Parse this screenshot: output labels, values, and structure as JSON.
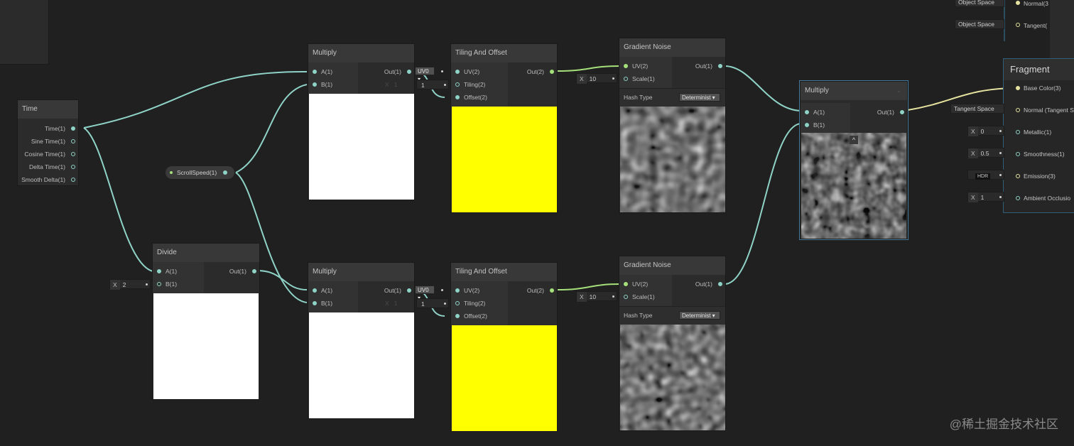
{
  "nodes": {
    "time": {
      "title": "Time",
      "outputs": [
        "Time(1)",
        "Sine Time(1)",
        "Cosine Time(1)",
        "Delta Time(1)",
        "Smooth Delta(1)"
      ]
    },
    "scroll_speed": {
      "label": "ScrollSpeed(1)"
    },
    "divide": {
      "title": "Divide",
      "in_a": "A(1)",
      "in_b": "B(1)",
      "out": "Out(1)",
      "b_axis": "X",
      "b_value": "2"
    },
    "multiply_top": {
      "title": "Multiply",
      "in_a": "A(1)",
      "in_b": "B(1)",
      "out": "Out(1)",
      "b_axis": "X",
      "b_value": "1"
    },
    "multiply_bottom": {
      "title": "Multiply",
      "in_a": "A(1)",
      "in_b": "B(1)",
      "out": "Out(1)",
      "b_axis": "X",
      "b_value": "1"
    },
    "tiling_top": {
      "title": "Tiling And Offset",
      "in_uv": "UV(2)",
      "in_tiling": "Tiling(2)",
      "in_offset": "Offset(2)",
      "out": "Out(2)",
      "uv_dropdown": "UV0",
      "tiling_value": "1"
    },
    "tiling_bottom": {
      "title": "Tiling And Offset",
      "in_uv": "UV(2)",
      "in_tiling": "Tiling(2)",
      "in_offset": "Offset(2)",
      "out": "Out(2)",
      "uv_dropdown": "UV0",
      "tiling_value": "1"
    },
    "noise_top": {
      "title": "Gradient Noise",
      "in_uv": "UV(2)",
      "in_scale": "Scale(1)",
      "out": "Out(1)",
      "scale_axis": "X",
      "scale_value": "10",
      "hash_label": "Hash Type",
      "hash_value": "Determinist"
    },
    "noise_bottom": {
      "title": "Gradient Noise",
      "in_uv": "UV(2)",
      "in_scale": "Scale(1)",
      "out": "Out(1)",
      "scale_axis": "X",
      "scale_value": "10",
      "hash_label": "Hash Type",
      "hash_value": "Determinist"
    },
    "multiply_final": {
      "title": "Multiply",
      "in_a": "A(1)",
      "in_b": "B(1)",
      "out": "Out(1)"
    }
  },
  "vertex_partial": {
    "inputs": [
      {
        "space": "Object Space",
        "port": "Normal(3"
      },
      {
        "space": "Object Space",
        "port": "Tangent("
      }
    ]
  },
  "fragment": {
    "title": "Fragment",
    "ports": [
      {
        "label": "Base Color(3)",
        "input": ""
      },
      {
        "label": "Normal (Tangent S",
        "input": "Tangent Space"
      },
      {
        "label": "Metallic(1)",
        "input_axis": "X",
        "input": "0"
      },
      {
        "label": "Smoothness(1)",
        "input_axis": "X",
        "input": "0.5"
      },
      {
        "label": "Emission(3)",
        "input": "HDR"
      },
      {
        "label": "Ambient Occlusio",
        "input_axis": "X",
        "input": "1"
      }
    ]
  },
  "watermark": "@稀土掘金技术社区",
  "colors": {
    "background": "#202020",
    "wire": "#8fd3c7",
    "wire_uv": "#a5e07a",
    "wire_color": "#e6e3a0",
    "yellow_preview": "#ffff00",
    "white_preview": "#ffffff"
  }
}
